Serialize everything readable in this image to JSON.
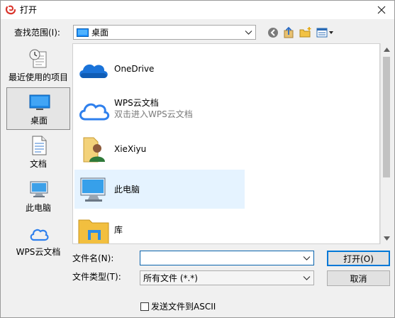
{
  "window": {
    "title": "打开"
  },
  "look_in": {
    "label": "查找范围(I):",
    "value": "桌面"
  },
  "places": [
    {
      "label": "最近使用的项目"
    },
    {
      "label": "桌面"
    },
    {
      "label": "文档"
    },
    {
      "label": "此电脑"
    },
    {
      "label": "WPS云文档"
    }
  ],
  "files": [
    {
      "name": "OneDrive",
      "sub": ""
    },
    {
      "name": "WPS云文档",
      "sub": "双击进入WPS云文档"
    },
    {
      "name": "XieXiyu",
      "sub": ""
    },
    {
      "name": "此电脑",
      "sub": ""
    },
    {
      "name": "库",
      "sub": ""
    }
  ],
  "filename": {
    "label": "文件名(N):",
    "value": "",
    "placeholder": ""
  },
  "filetype": {
    "label": "文件类型(T):",
    "value": "所有文件 (*.*)"
  },
  "buttons": {
    "open": "打开(O)",
    "cancel": "取消"
  },
  "ascii_checkbox": {
    "label": "发送文件到ASCII",
    "checked": false
  },
  "colors": {
    "accent": "#0078d7",
    "selection_bg": "#e5f3ff"
  }
}
